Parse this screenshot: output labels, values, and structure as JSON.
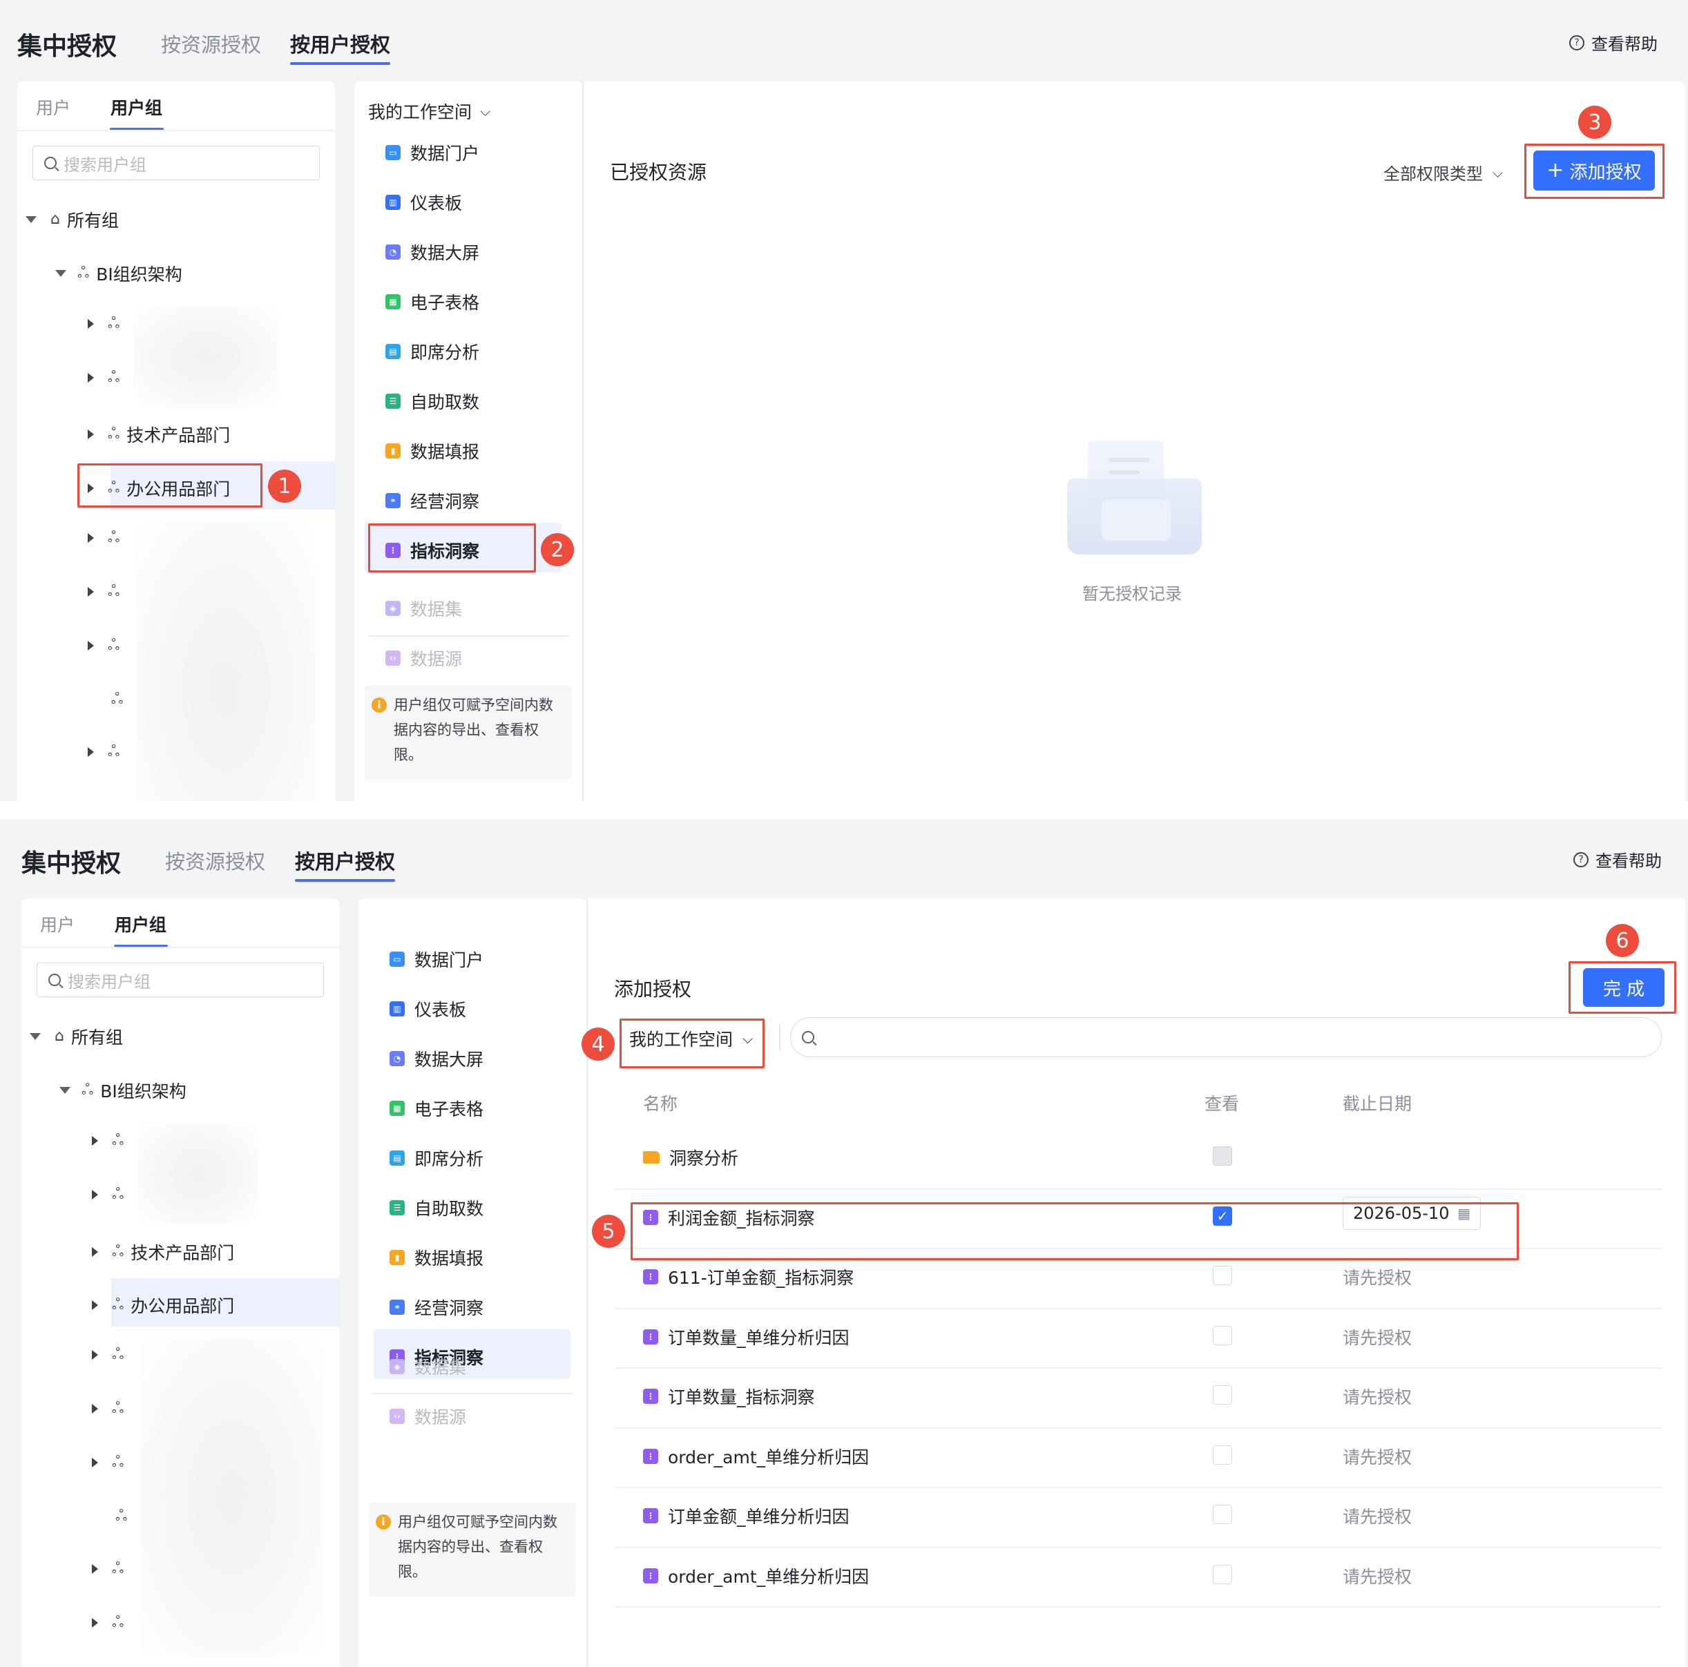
{
  "header": {
    "title": "集中授权",
    "tabs": [
      "按资源授权",
      "按用户授权"
    ],
    "active_tab": "按用户授权",
    "help": "查看帮助"
  },
  "sidebar": {
    "tabs": [
      "用户",
      "用户组"
    ],
    "active_tab": "用户组",
    "search_placeholder": "搜索用户组",
    "tree": {
      "root": "所有组",
      "org": "BI组织架构",
      "dept_tech": "技术产品部门",
      "dept_office": "办公用品部门"
    }
  },
  "workspace": {
    "selector": "我的工作空间"
  },
  "resource_menu": {
    "items": [
      "数据门户",
      "仪表板",
      "数据大屏",
      "电子表格",
      "即席分析",
      "自助取数",
      "数据填报",
      "经营洞察",
      "指标洞察"
    ],
    "disabled_items": [
      "数据集",
      "数据源"
    ],
    "active": "指标洞察",
    "notice": "用户组仅可赋予空间内数据内容的导出、查看权限。",
    "notice_lines": [
      "用户组仅可赋予空间内数",
      "据内容的导出、查看权",
      "限。"
    ]
  },
  "authorized": {
    "title": "已授权资源",
    "filter": "全部权限类型",
    "add_button": "添加授权",
    "empty_text": "暂无授权记录"
  },
  "add_auth": {
    "title": "添加授权",
    "done_button": "完 成",
    "workspace": "我的工作空间",
    "columns": {
      "name": "名称",
      "view": "查看",
      "deadline": "截止日期"
    },
    "rows": [
      {
        "name": "洞察分析",
        "type": "folder",
        "view": "disabled",
        "deadline": ""
      },
      {
        "name": "利润金额_指标洞察",
        "type": "metric",
        "view": "checked",
        "deadline": "2026-05-10"
      },
      {
        "name": "611-订单金额_指标洞察",
        "type": "metric",
        "view": "unchecked",
        "deadline": "请先授权"
      },
      {
        "name": "订单数量_单维分析归因",
        "type": "metric",
        "view": "unchecked",
        "deadline": "请先授权"
      },
      {
        "name": "订单数量_指标洞察",
        "type": "metric",
        "view": "unchecked",
        "deadline": "请先授权"
      },
      {
        "name": "order_amt_单维分析归因",
        "type": "metric",
        "view": "unchecked",
        "deadline": "请先授权"
      },
      {
        "name": "订单金额_单维分析归因",
        "type": "metric",
        "view": "unchecked",
        "deadline": "请先授权"
      },
      {
        "name": "order_amt_单维分析归因",
        "type": "metric",
        "view": "unchecked",
        "deadline": "请先授权"
      }
    ]
  },
  "steps": [
    "1",
    "2",
    "3",
    "4",
    "5",
    "6"
  ],
  "colors": {
    "accent": "#3370ff",
    "highlight_border": "#e84a3c",
    "step_badge": "#ee4c3c",
    "tab_underline": "#4e6ef2",
    "selected_bg": "#ecf1fd"
  },
  "icons": {
    "数据门户": "#3a8ff7",
    "仪表板": "#3370ff",
    "数据大屏": "#6b7cf6",
    "电子表格": "#34c26b",
    "即席分析": "#2fa4e8",
    "自助取数": "#27b485",
    "数据填报": "#f5a623",
    "经营洞察": "#4a7cf7",
    "指标洞察": "#8f5cf0",
    "数据集": "#c4b5f7",
    "数据源": "#d2b6f5"
  }
}
